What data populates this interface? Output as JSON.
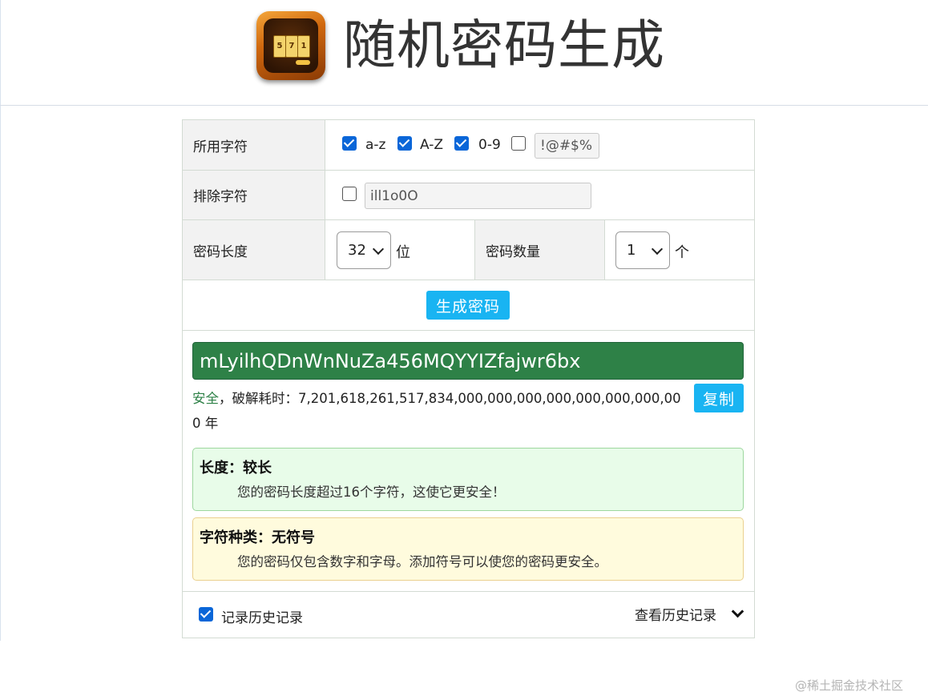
{
  "header": {
    "title": "随机密码生成"
  },
  "chars": {
    "label": "所用字符",
    "lower": {
      "label": "a-z",
      "checked": true
    },
    "upper": {
      "label": "A-Z",
      "checked": true
    },
    "digits": {
      "label": "0-9",
      "checked": true
    },
    "symbols": {
      "checked": false,
      "value": "!@#$%"
    }
  },
  "exclude": {
    "label": "排除字符",
    "checked": false,
    "value": "ill1o0O"
  },
  "length": {
    "label": "密码长度",
    "selected": "32",
    "unit": "位"
  },
  "count": {
    "label": "密码数量",
    "selected": "1",
    "unit": "个"
  },
  "generate_button": "生成密码",
  "result": {
    "password": "mLyilhQDnWnNuZa456MQYYIZfajwr6bx",
    "safety": "安全",
    "crack_time": "，破解耗时：7,201,618,261,517,834,000,000,000,000,000,000,000,000 年",
    "copy_button": "复制"
  },
  "tips": [
    {
      "title": "长度：较长",
      "text": "您的密码长度超过16个字符，这使它更安全！"
    },
    {
      "title": "字符种类：无符号",
      "text": "您的密码仅包含数字和字母。添加符号可以使您的密码更安全。"
    }
  ],
  "history": {
    "record_label": "记录历史记录",
    "record_checked": true,
    "view_label": "查看历史记录"
  },
  "watermark": "@稀土掘金技术社区",
  "colors": {
    "accent": "#19b4f2",
    "password_bg": "#2e8147",
    "checkbox": "#0a66d8"
  }
}
